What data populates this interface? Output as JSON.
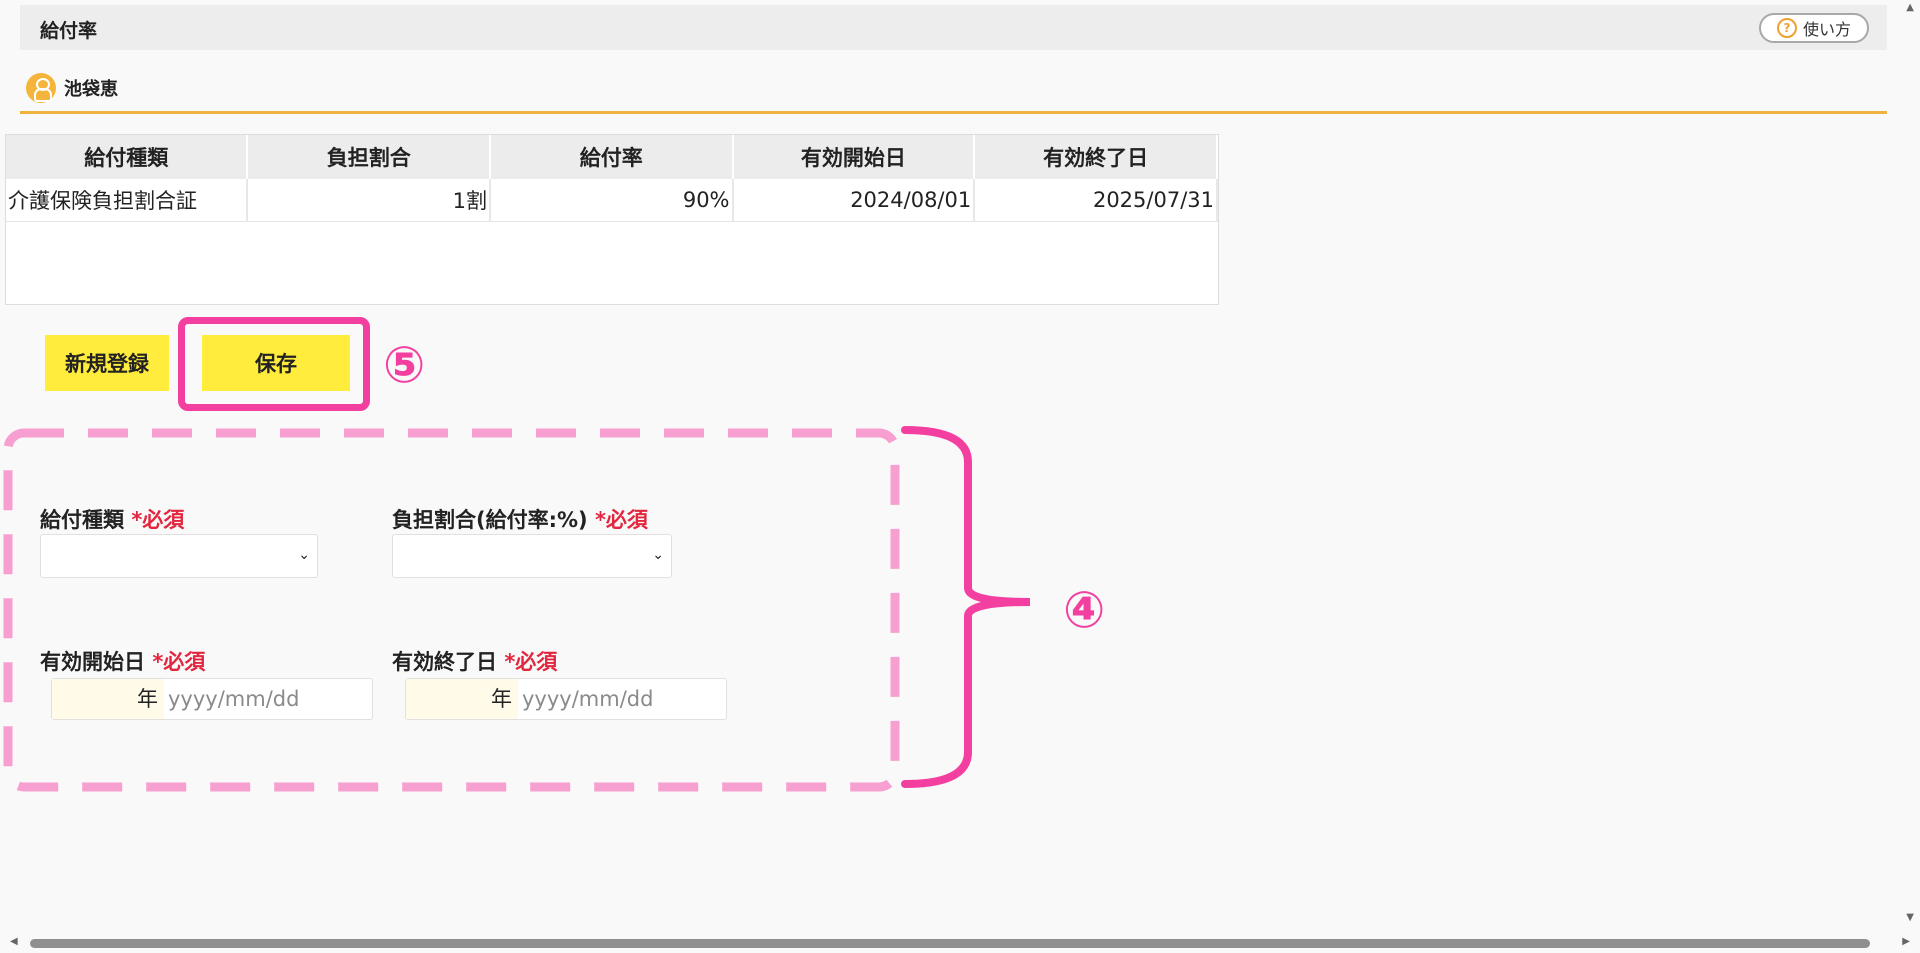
{
  "header": {
    "title": "給付率",
    "help_label": "使い方"
  },
  "user": {
    "name": "池袋恵"
  },
  "table": {
    "columns": [
      "給付種類",
      "負担割合",
      "給付率",
      "有効開始日",
      "有効終了日"
    ],
    "rows": [
      [
        "介護保険負担割合証",
        "1割",
        "90%",
        "2024/08/01",
        "2025/07/31"
      ]
    ]
  },
  "buttons": {
    "new_label": "新規登録",
    "save_label": "保存"
  },
  "annotations": {
    "save_marker": "⑤",
    "form_marker": "④",
    "color": "#f23fa0"
  },
  "form": {
    "benefit_type_label": "給付種類",
    "burden_ratio_label": "負担割合(給付率:%)",
    "start_date_label": "有効開始日",
    "end_date_label": "有効終了日",
    "required_label": "*必須",
    "year_label": "年",
    "date_placeholder": "yyyy/mm/dd"
  },
  "colors": {
    "accent_yellow": "#ffec3d",
    "accent_orange": "#f0b23e",
    "required_red": "#e3263f"
  }
}
